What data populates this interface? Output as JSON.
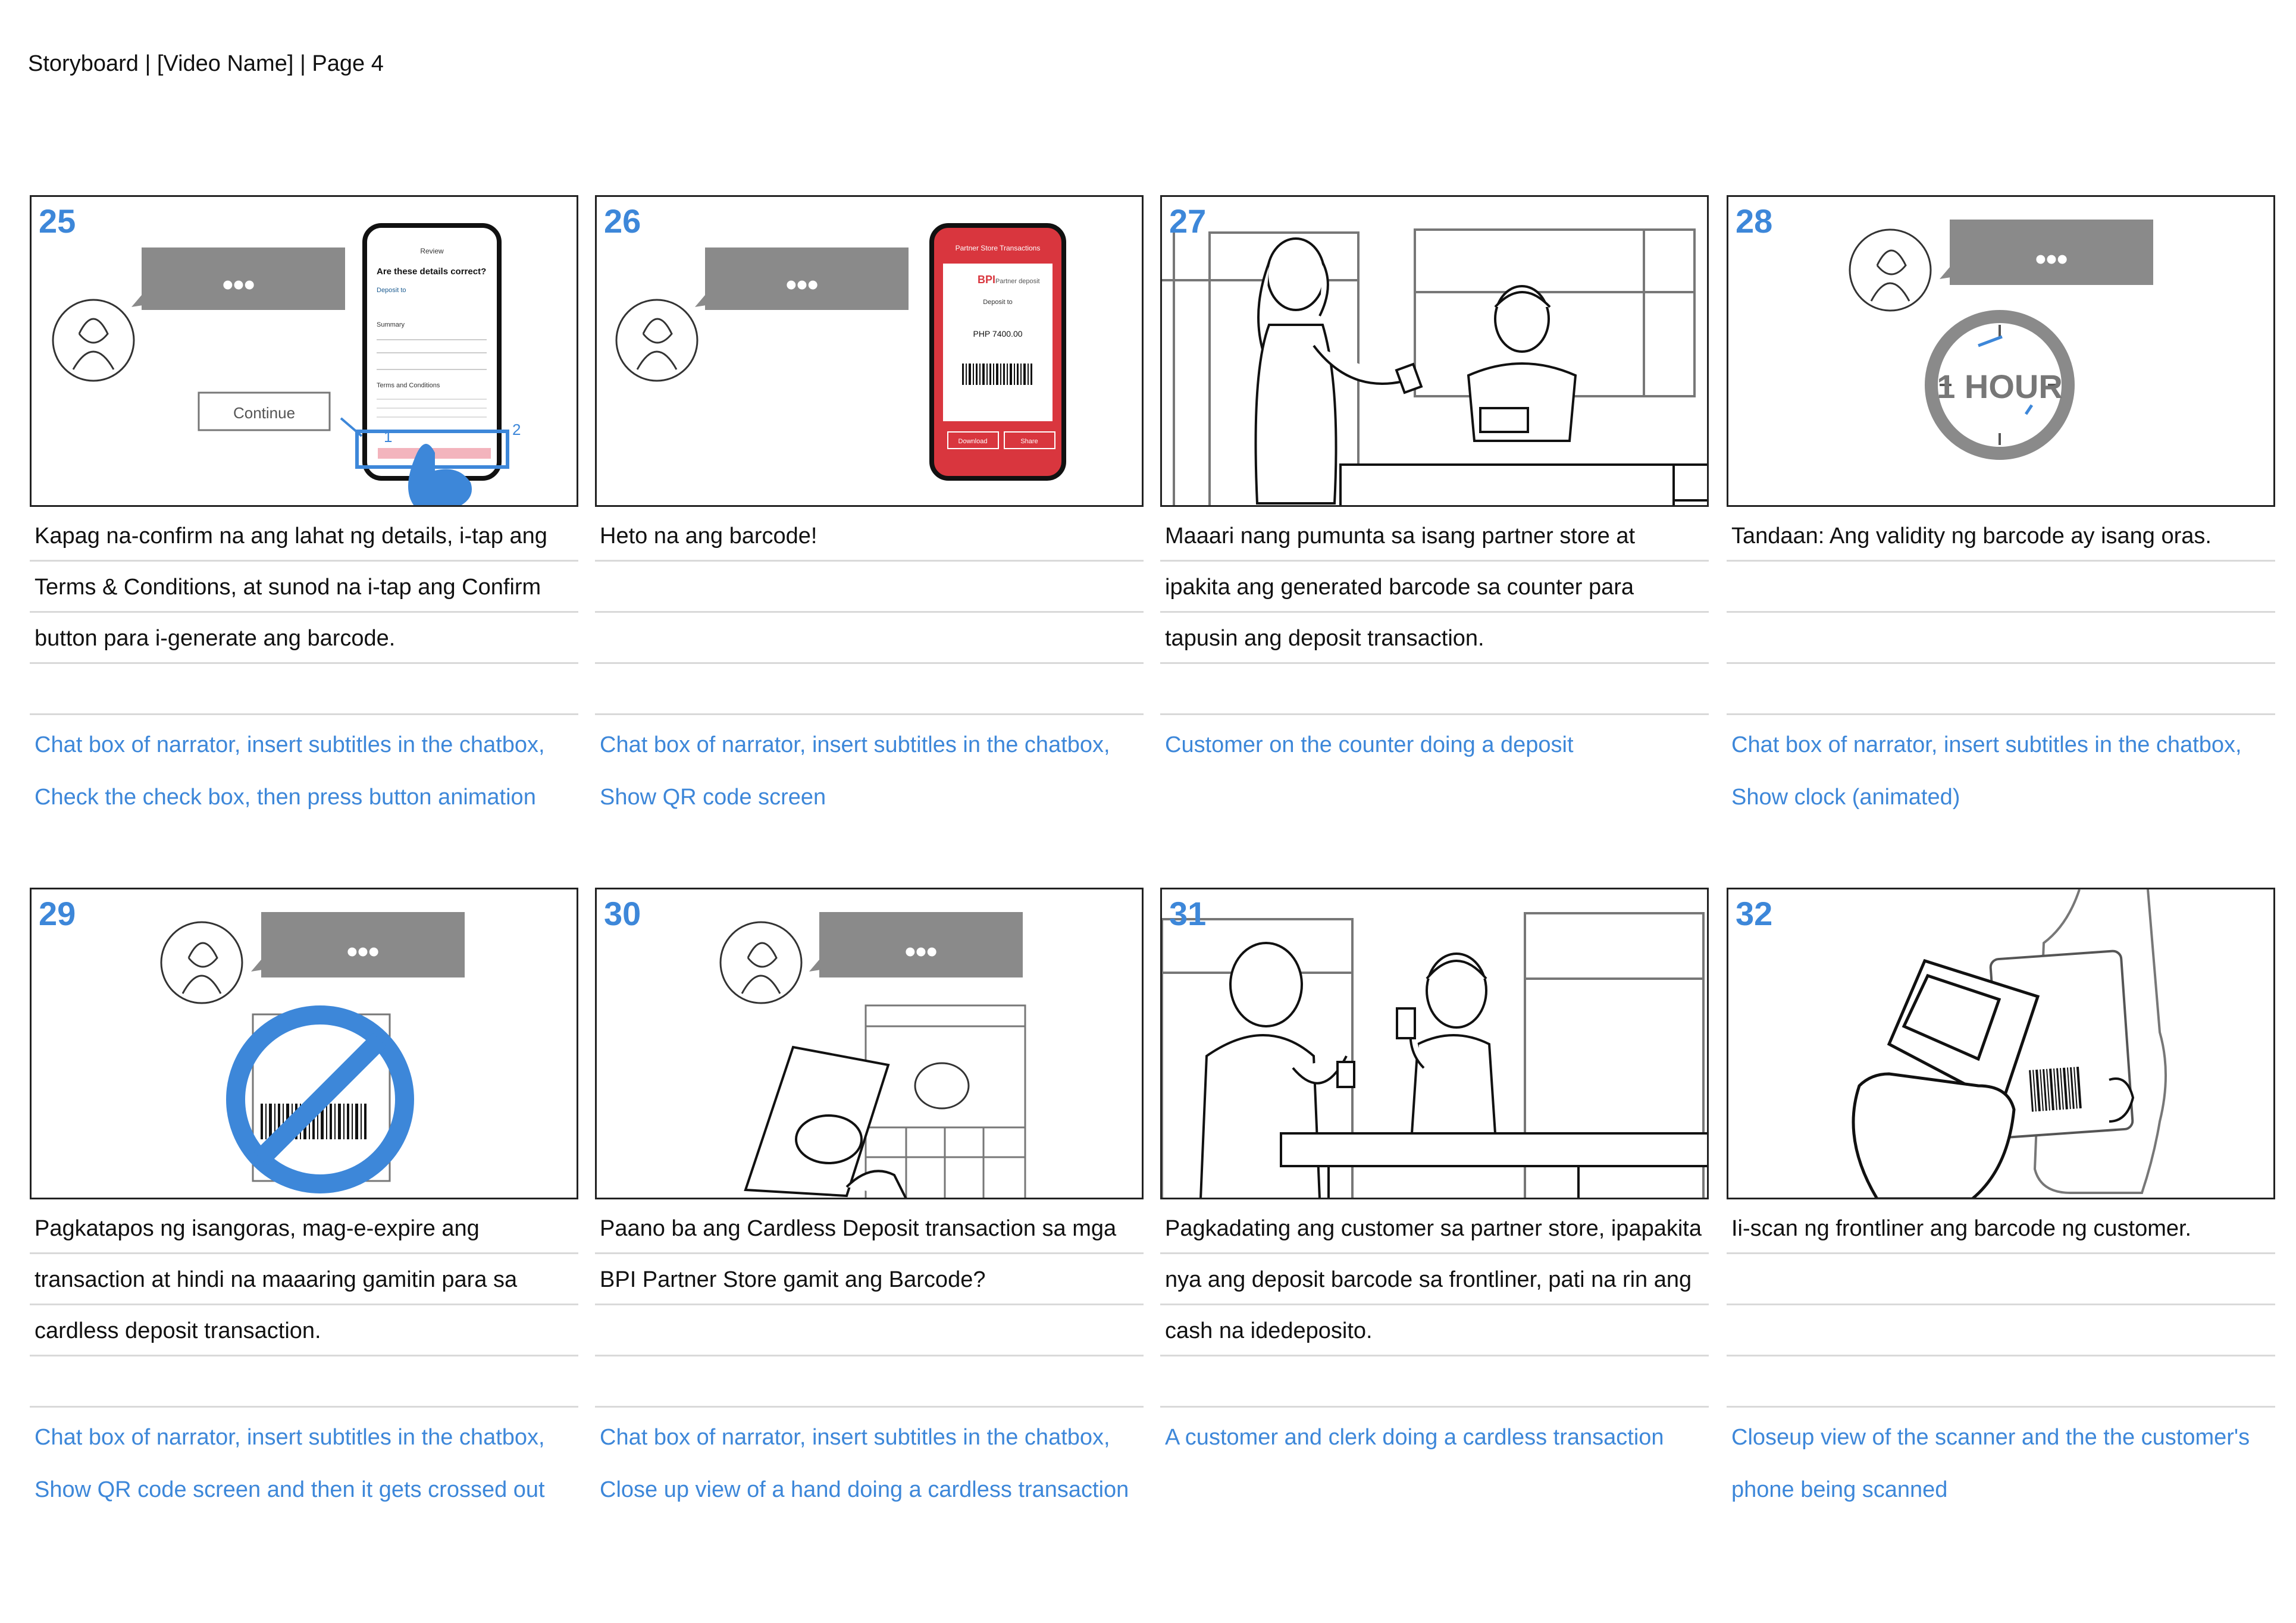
{
  "header": {
    "title": "Storyboard | [Video Name] | Page 4"
  },
  "colors": {
    "accent": "#3d87d9",
    "bubble": "#8a8a8a",
    "sketch": "#222222",
    "rule": "#d9d9d9"
  },
  "panels": [
    {
      "number": "25",
      "lines": [
        "Kapag na-confirm na ang lahat ng details, i-tap ang",
        "Terms & Conditions, at sunod na i-tap ang Confirm",
        "button para i-generate ang barcode."
      ],
      "notes": [
        "Chat box of narrator, insert subtitles in the chatbox,",
        "Check the check box, then press button animation"
      ],
      "art": {
        "bubble": "•••",
        "continue_label": "Continue",
        "phone_title": "Review",
        "phone_heading": "Are these details correct?",
        "phone_deposit": "Deposit to",
        "phone_summary": "Summary",
        "phone_terms": "Terms and Conditions",
        "step_1": "1",
        "step_2": "2"
      }
    },
    {
      "number": "26",
      "lines": [
        "Heto na ang barcode!",
        "",
        ""
      ],
      "notes": [
        "Chat box of narrator, insert subtitles in the chatbox,",
        "Show QR code screen"
      ],
      "art": {
        "bubble": "•••",
        "phone_title": "Partner Store Transactions",
        "phone_brand": "BPI",
        "phone_brand_sub": "Partner deposit",
        "phone_deposit": "Deposit to",
        "phone_amount": "PHP 7400.00",
        "download_label": "Download",
        "share_label": "Share"
      }
    },
    {
      "number": "27",
      "lines": [
        "Maaari nang pumunta sa isang partner store at",
        "ipakita ang generated barcode sa counter para",
        "tapusin ang deposit transaction."
      ],
      "notes": [
        "Customer on the counter doing a deposit",
        ""
      ],
      "art": {}
    },
    {
      "number": "28",
      "lines": [
        "Tandaan: Ang validity ng barcode ay isang oras.",
        "",
        ""
      ],
      "notes": [
        "Chat box of narrator, insert subtitles in the chatbox,",
        "Show clock (animated)"
      ],
      "art": {
        "bubble": "•••",
        "clock_label": "1 HOUR"
      }
    },
    {
      "number": "29",
      "lines": [
        "Pagkatapos ng isangoras, mag-e-expire ang",
        "transaction at hindi na maaaring gamitin para sa",
        "cardless deposit transaction."
      ],
      "notes": [
        "Chat box of narrator, insert subtitles in the chatbox,",
        "Show QR code screen and then it gets crossed out"
      ],
      "art": {
        "bubble": "•••"
      }
    },
    {
      "number": "30",
      "lines": [
        "Paano ba ang Cardless Deposit transaction sa mga",
        "BPI Partner Store gamit ang Barcode?",
        ""
      ],
      "notes": [
        "Chat box of narrator, insert subtitles in the chatbox,",
        "Close up view of a hand doing a cardless transaction"
      ],
      "art": {
        "bubble": "•••"
      }
    },
    {
      "number": "31",
      "lines": [
        "Pagkadating ang customer sa partner store, ipapakita",
        "nya ang deposit barcode sa frontliner, pati na rin ang",
        "cash na idedeposito."
      ],
      "notes": [
        "A customer and clerk doing a cardless transaction",
        ""
      ],
      "art": {}
    },
    {
      "number": "32",
      "lines": [
        "Ii-scan ng frontliner ang barcode ng customer.",
        "",
        ""
      ],
      "notes": [
        "Closeup view of the scanner and the the customer's",
        "phone being scanned"
      ],
      "art": {}
    }
  ]
}
